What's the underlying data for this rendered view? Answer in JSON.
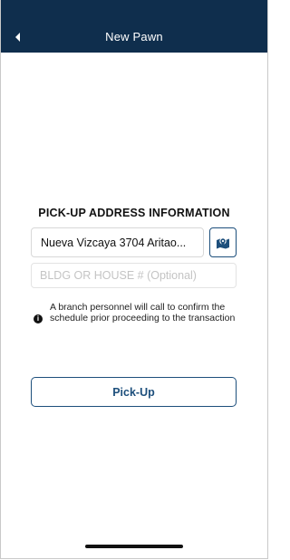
{
  "header": {
    "title": "New Pawn",
    "back_icon": "chevron-left-icon",
    "background": "#0f2e4d"
  },
  "pickup": {
    "section_title": "PICK-UP ADDRESS INFORMATION",
    "address_value": "Nueva Vizcaya 3704 Aritao...",
    "map_icon": "map-pin-icon",
    "bldg_placeholder": "BLDG OR HOUSE # (Optional)",
    "bldg_value": "",
    "note_icon": "info-icon",
    "note_text": "A branch personnel will call to confirm the schedule prior proceeding to the transaction",
    "button_label": "Pick-Up",
    "accent_color": "#1d4f7c"
  }
}
